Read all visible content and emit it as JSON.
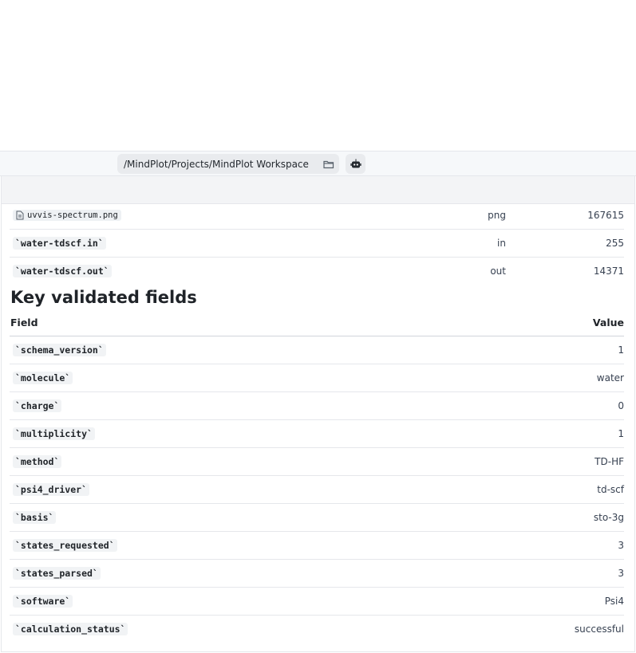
{
  "toolbar": {
    "path": "/MindPlot/Projects/MindPlot Workspace"
  },
  "files": [
    {
      "name": "uvvis-spectrum.png",
      "ext": "png",
      "size": "167615"
    },
    {
      "name": "`water-tdscf.in`",
      "ext": "in",
      "size": "255"
    },
    {
      "name": "`water-tdscf.out`",
      "ext": "out",
      "size": "14371"
    }
  ],
  "section": {
    "title": "Key validated fields",
    "col_field": "Field",
    "col_value": "Value"
  },
  "fields": [
    {
      "key": "`schema_version`",
      "value": "1"
    },
    {
      "key": "`molecule`",
      "value": "water"
    },
    {
      "key": "`charge`",
      "value": "0"
    },
    {
      "key": "`multiplicity`",
      "value": "1"
    },
    {
      "key": "`method`",
      "value": "TD-HF"
    },
    {
      "key": "`psi4_driver`",
      "value": "td-scf"
    },
    {
      "key": "`basis`",
      "value": "sto-3g"
    },
    {
      "key": "`states_requested`",
      "value": "3"
    },
    {
      "key": "`states_parsed`",
      "value": "3"
    },
    {
      "key": "`software`",
      "value": "Psi4"
    },
    {
      "key": "`calculation_status`",
      "value": "successful"
    }
  ]
}
